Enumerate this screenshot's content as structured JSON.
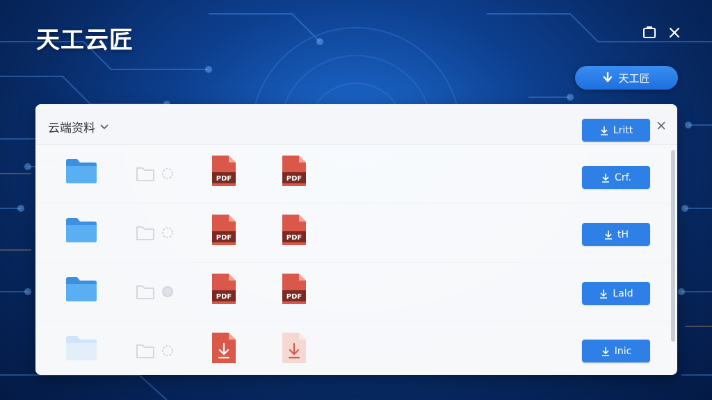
{
  "header": {
    "brand": "天工云匠",
    "action_button_label": "天工匠"
  },
  "panel": {
    "title": "云端资料",
    "header_button_label": "Lritt"
  },
  "rows": [
    {
      "file1_label": "PDF",
      "file2_label": "PDF",
      "button_label": "Crf."
    },
    {
      "file1_label": "PDF",
      "file2_label": "PDF",
      "button_label": "tH"
    },
    {
      "file1_label": "PDF",
      "file2_label": "PDF",
      "button_label": "Lald"
    },
    {
      "button_label": "Inic"
    }
  ],
  "icons": {
    "brand": "brand-text",
    "window_restore": "window-restore-icon",
    "window_close": "close-icon",
    "action": "arrow-down-icon",
    "dropdown": "chevron-down-icon",
    "panel_close": "close-icon",
    "folder": "folder-icon",
    "ghost_folder": "folder-outline-icon",
    "sync": "sync-icon",
    "pdf": "pdf-file-icon",
    "download": "download-icon"
  },
  "colors": {
    "accent": "#2f80e6",
    "pill": "#1e6fe0",
    "pdf": "#d9584a",
    "pdf_band": "#7a2a22",
    "folder": "#4a9de8",
    "background": "#0d3f8f"
  }
}
